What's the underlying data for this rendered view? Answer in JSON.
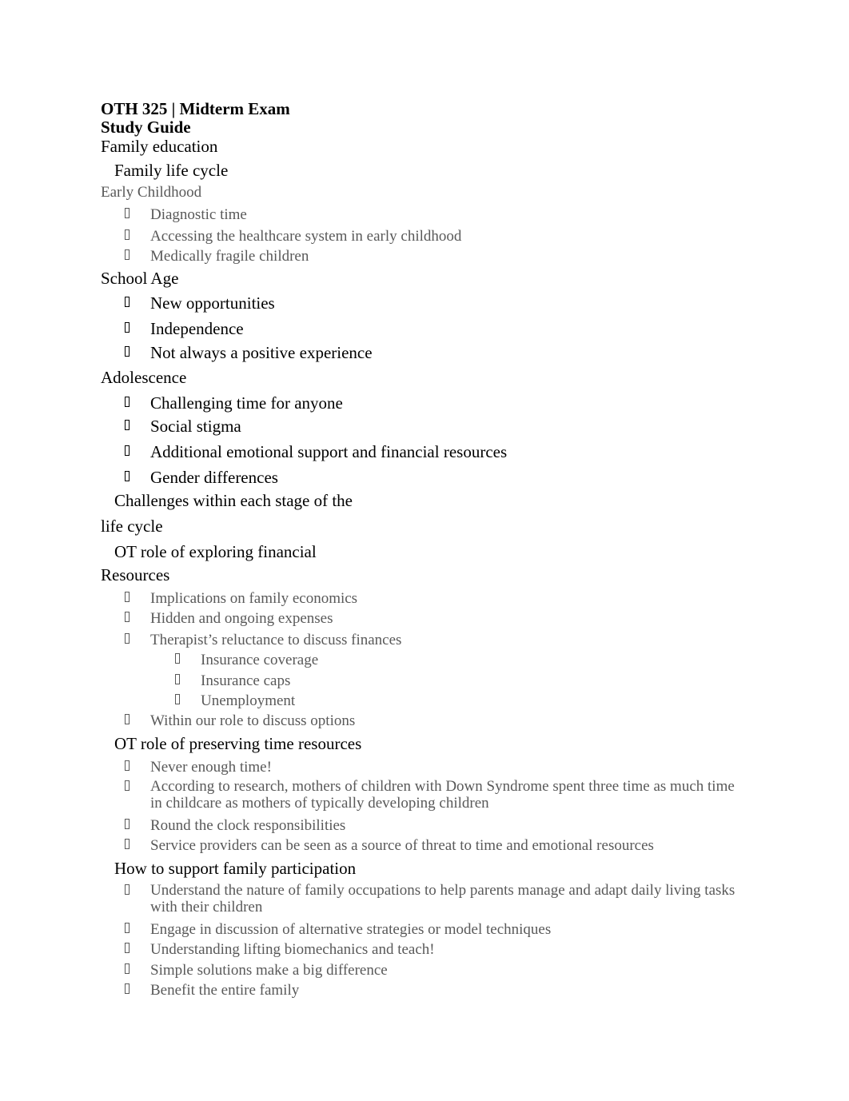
{
  "document": {
    "title_line1": "OTH 325 | Midterm Exam",
    "title_line2": "Study Guide",
    "family_education": "Family education",
    "family_life_cycle": "Family life cycle",
    "early_childhood": {
      "label": "Early Childhood",
      "items": [
        "Diagnostic time",
        "Accessing the healthcare system in early childhood",
        "Medically fragile children"
      ]
    },
    "school_age": {
      "label": "School Age",
      "items": [
        "New opportunities",
        "Independence",
        "Not always a positive experience"
      ]
    },
    "adolescence": {
      "label": "Adolescence",
      "items": [
        "Challenging time for anyone",
        "Social stigma",
        "Additional emotional support and financial resources",
        "Gender differences"
      ]
    },
    "challenges_line1": "Challenges within each stage of the",
    "challenges_line2": "life cycle",
    "financial_line1": "OT role of exploring financial",
    "financial_line2": "Resources",
    "financial_items": [
      "Implications on family economics",
      "Hidden and ongoing expenses",
      "Therapist’s reluctance to discuss finances"
    ],
    "financial_subitems": [
      "Insurance coverage",
      "Insurance caps",
      "Unemployment"
    ],
    "financial_last": "Within our role to discuss options",
    "time_heading": "OT role of preserving time resources",
    "time_items": [
      "Never enough time!",
      "According to research, mothers of children with Down Syndrome spent three time as much time in childcare as mothers of typically developing children",
      "Round the clock responsibilities",
      "Service providers can be seen as a source of threat to time and emotional resources"
    ],
    "participation_heading": "How to support family participation",
    "participation_items": [
      "Understand the nature of family occupations to help parents manage and adapt daily living tasks with their children",
      "Engage in discussion of alternative strategies or model techniques",
      "Understanding lifting biomechanics and teach!",
      "Simple solutions make a big difference",
      "Benefit the entire family"
    ],
    "bullet_icon": "missing-glyph-box"
  }
}
